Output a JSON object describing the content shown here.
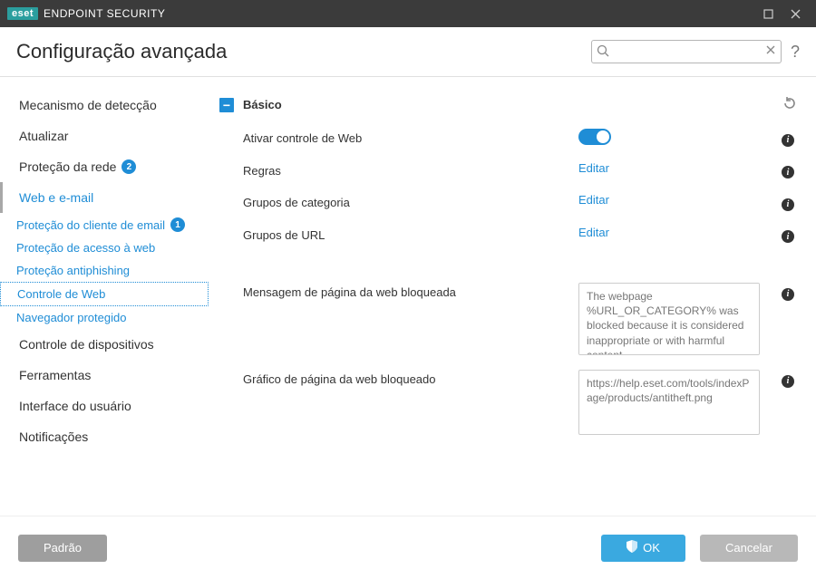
{
  "titlebar": {
    "brand_box": "eset",
    "product": "ENDPOINT SECURITY"
  },
  "header": {
    "title": "Configuração avançada",
    "search_placeholder": ""
  },
  "sidebar": {
    "items": [
      {
        "label": "Mecanismo de detecção"
      },
      {
        "label": "Atualizar"
      },
      {
        "label": "Proteção da rede",
        "badge": "2"
      },
      {
        "label": "Web e e-mail",
        "active": true
      },
      {
        "label": "Controle de dispositivos"
      },
      {
        "label": "Ferramentas"
      },
      {
        "label": "Interface do usuário"
      },
      {
        "label": "Notificações"
      }
    ],
    "sub": [
      {
        "label": "Proteção do cliente de email",
        "badge": "1"
      },
      {
        "label": "Proteção de acesso à web"
      },
      {
        "label": "Proteção antiphishing"
      },
      {
        "label": "Controle de Web",
        "selected": true
      },
      {
        "label": "Navegador protegido"
      }
    ]
  },
  "section": {
    "title": "Básico",
    "rows": {
      "enable": {
        "label": "Ativar controle de Web"
      },
      "rules": {
        "label": "Regras",
        "action": "Editar"
      },
      "catgrp": {
        "label": "Grupos de categoria",
        "action": "Editar"
      },
      "urlgrp": {
        "label": "Grupos de URL",
        "action": "Editar"
      },
      "blockmsg": {
        "label": "Mensagem de página da web bloqueada",
        "value": "The webpage %URL_OR_CATEGORY% was blocked because it is considered inappropriate or with harmful content."
      },
      "blockimg": {
        "label": "Gráfico de página da web bloqueado",
        "value": "https://help.eset.com/tools/indexPage/products/antitheft.png"
      }
    }
  },
  "footer": {
    "default": "Padrão",
    "ok": "OK",
    "cancel": "Cancelar"
  }
}
